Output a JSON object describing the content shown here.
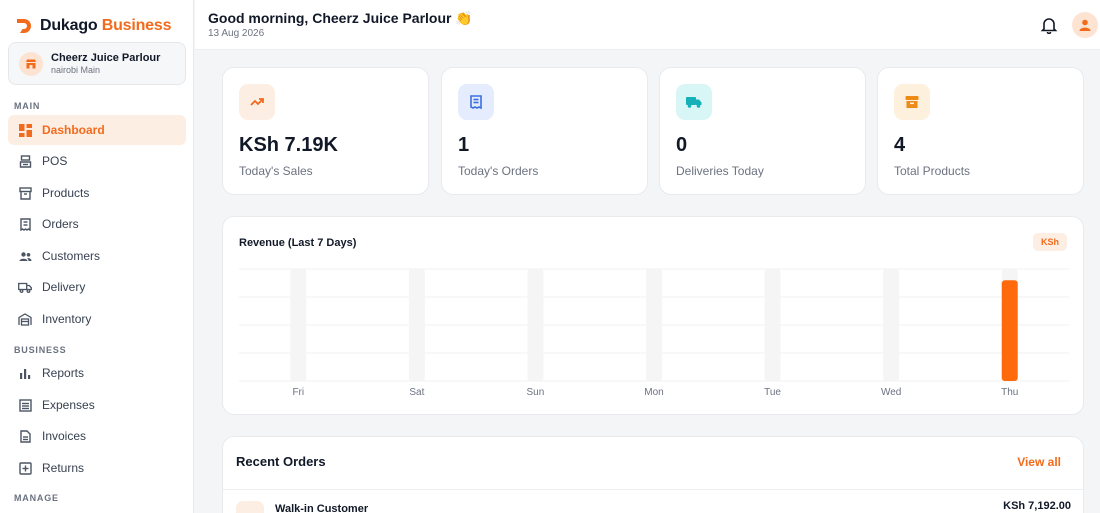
{
  "brand": {
    "name_part1": "Dukago",
    "name_part2": "Business"
  },
  "store": {
    "name": "Cheerz Juice Parlour",
    "branch": "nairobi Main"
  },
  "sidebar": {
    "sections": {
      "main": "MAIN",
      "business": "BUSINESS",
      "manage": "MANAGE"
    },
    "items": [
      {
        "label": "Dashboard",
        "icon": "dashboard-icon",
        "active": true
      },
      {
        "label": "POS",
        "icon": "register-icon"
      },
      {
        "label": "Products",
        "icon": "box-icon"
      },
      {
        "label": "Orders",
        "icon": "receipt-icon"
      },
      {
        "label": "Customers",
        "icon": "people-icon"
      },
      {
        "label": "Delivery",
        "icon": "truck-icon"
      },
      {
        "label": "Inventory",
        "icon": "warehouse-icon"
      },
      {
        "label": "Reports",
        "icon": "bar-chart-icon"
      },
      {
        "label": "Expenses",
        "icon": "list-icon"
      },
      {
        "label": "Invoices",
        "icon": "document-icon"
      },
      {
        "label": "Returns",
        "icon": "return-icon"
      }
    ]
  },
  "header": {
    "greeting": "Good morning, Cheerz Juice Parlour 👏",
    "date": "13 Aug 2026"
  },
  "stats": [
    {
      "value": "KSh 7.19K",
      "label": "Today's Sales",
      "icon": "trend-up-icon",
      "bg": "#fdeee4",
      "fg": "#f26b1d"
    },
    {
      "value": "1",
      "label": "Today's Orders",
      "icon": "receipt-icon",
      "bg": "#e4ecfd",
      "fg": "#3b6fe0"
    },
    {
      "value": "0",
      "label": "Deliveries Today",
      "icon": "truck-icon",
      "bg": "#d9f6f6",
      "fg": "#16b1b8"
    },
    {
      "value": "4",
      "label": "Total Products",
      "icon": "archive-icon",
      "bg": "#fdf0dc",
      "fg": "#ee8a16"
    }
  ],
  "revenue": {
    "title": "Revenue (Last 7 Days)",
    "currency_badge": "KSh"
  },
  "chart_data": {
    "type": "bar",
    "categories": [
      "Fri",
      "Sat",
      "Sun",
      "Mon",
      "Tue",
      "Wed",
      "Thu"
    ],
    "values": [
      0,
      0,
      0,
      0,
      0,
      0,
      7192
    ],
    "title": "Revenue (Last 7 Days)",
    "xlabel": "",
    "ylabel": "",
    "ylim": [
      0,
      8000
    ],
    "grid": true,
    "accent_color": "#ff6a0d",
    "track_color": "#f5f5f6"
  },
  "recent_orders": {
    "title": "Recent Orders",
    "view_all": "View all",
    "orders": [
      {
        "customer": "Walk-in Customer",
        "amount": "KSh 7,192.00"
      }
    ]
  },
  "colors": {
    "accent": "#f26b1d"
  }
}
